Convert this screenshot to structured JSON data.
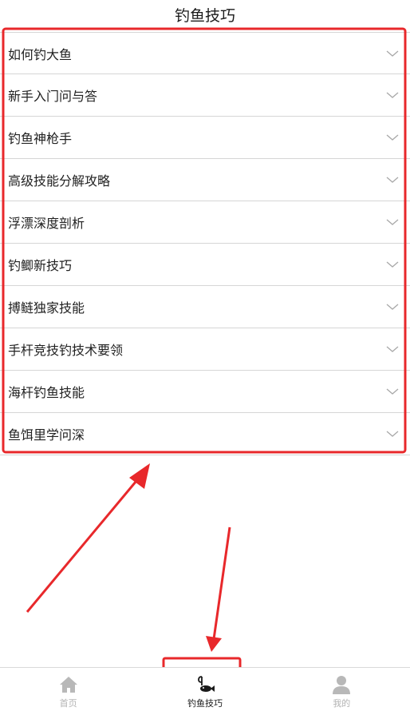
{
  "header": {
    "title": "钓鱼技巧"
  },
  "list": {
    "items": [
      {
        "label": "如何钓大鱼"
      },
      {
        "label": "新手入门问与答"
      },
      {
        "label": "钓鱼神枪手"
      },
      {
        "label": "高级技能分解攻略"
      },
      {
        "label": "浮漂深度剖析"
      },
      {
        "label": "钓鲫新技巧"
      },
      {
        "label": "搏鲢独家技能"
      },
      {
        "label": "手杆竞技钓技术要领"
      },
      {
        "label": "海杆钓鱼技能"
      },
      {
        "label": "鱼饵里学问深"
      }
    ],
    "chevron_icon": "chevron-down-icon"
  },
  "tabbar": {
    "tabs": [
      {
        "label": "首页",
        "icon": "home-icon",
        "active": false
      },
      {
        "label": "钓鱼技巧",
        "icon": "fishing-hook-icon",
        "active": true
      },
      {
        "label": "我的",
        "icon": "user-icon",
        "active": false
      }
    ]
  },
  "colors": {
    "annotation_red": "#e8282b",
    "inactive_tab": "#b3b3b3",
    "divider": "#d6d6d6"
  }
}
